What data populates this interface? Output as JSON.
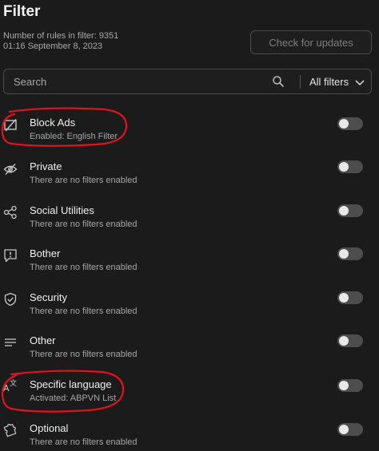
{
  "header": {
    "title": "Filter",
    "rules_text": "Number of rules in filter: 9351",
    "date_text": "01:16 September 8, 2023",
    "update_button": "Check for updates"
  },
  "search": {
    "placeholder": "Search",
    "filter_select": "All filters"
  },
  "categories": [
    {
      "title": "Block Ads",
      "subtitle": "Enabled: English Filter",
      "icon": "block-ads-icon",
      "enabled": false
    },
    {
      "title": "Private",
      "subtitle": "There are no filters enabled",
      "icon": "eye-slash-icon",
      "enabled": false
    },
    {
      "title": "Social Utilities",
      "subtitle": "There are no filters enabled",
      "icon": "share-icon",
      "enabled": false
    },
    {
      "title": "Bother",
      "subtitle": "There are no filters enabled",
      "icon": "alert-message-icon",
      "enabled": false
    },
    {
      "title": "Security",
      "subtitle": "There are no filters enabled",
      "icon": "shield-check-icon",
      "enabled": false
    },
    {
      "title": "Other",
      "subtitle": "There are no filters enabled",
      "icon": "lines-icon",
      "enabled": false
    },
    {
      "title": "Specific language",
      "subtitle": "Activated: ABPVN List",
      "icon": "translate-icon",
      "enabled": false
    },
    {
      "title": "Optional",
      "subtitle": "There are no filters enabled",
      "icon": "puzzle-icon",
      "enabled": false
    }
  ],
  "colors": {
    "background": "#1b1b1b",
    "annotation_red": "#e0141e"
  }
}
